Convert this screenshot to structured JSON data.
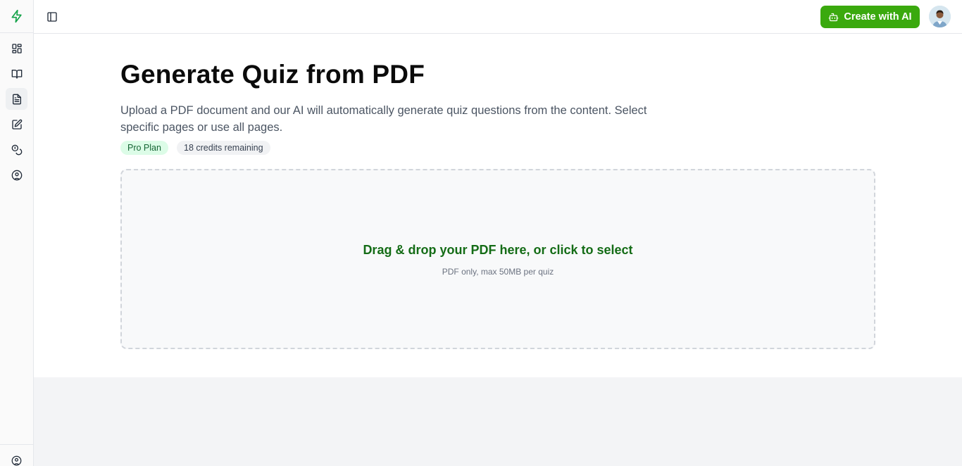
{
  "header": {
    "create_button_label": "Create with AI"
  },
  "sidebar": {
    "items": [
      {
        "icon": "dashboard-icon"
      },
      {
        "icon": "book-icon"
      },
      {
        "icon": "document-icon",
        "active": true
      },
      {
        "icon": "edit-icon"
      },
      {
        "icon": "coins-icon"
      },
      {
        "icon": "user-circle-icon"
      }
    ],
    "footer_icon": "user-circle-icon"
  },
  "main": {
    "title": "Generate Quiz from PDF",
    "description": "Upload a PDF document and our AI will automatically generate quiz questions from the content. Select specific pages or use all pages.",
    "plan_badge": "Pro Plan",
    "credits_badge": "18 credits remaining",
    "dropzone": {
      "title": "Drag & drop your PDF here, or click to select",
      "subtitle": "PDF only, max 50MB per quiz"
    }
  },
  "colors": {
    "accent": "#3aa90e",
    "dropzone_text": "#146c16",
    "plan_badge_bg": "#dcfce7"
  }
}
